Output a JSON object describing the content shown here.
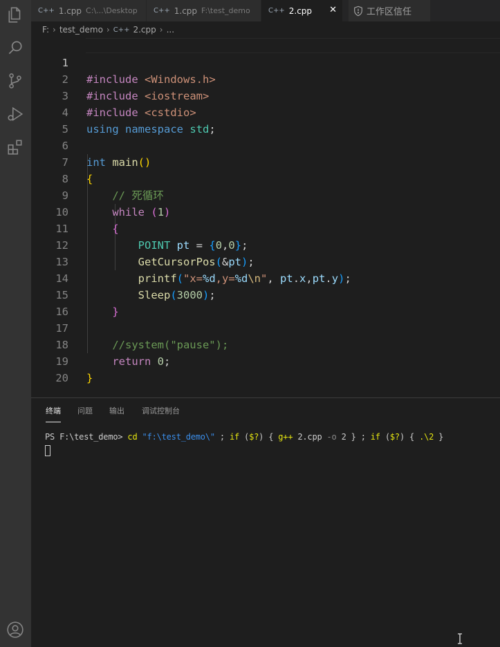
{
  "tabs": [
    {
      "label": "1.cpp",
      "path": "C:\\...\\Desktop",
      "active": false
    },
    {
      "label": "1.cpp",
      "path": "F:\\test_demo",
      "active": false
    },
    {
      "label": "2.cpp",
      "path": "",
      "active": true
    }
  ],
  "tab_icon": "C++",
  "close_glyph": "✕",
  "workspace_trust": "工作区信任",
  "breadcrumb": {
    "drive": "F:",
    "folder": "test_demo",
    "file": "2.cpp",
    "more": "..."
  },
  "editor": {
    "current_line": 1,
    "line_numbers": [
      "1",
      "2",
      "3",
      "4",
      "5",
      "6",
      "7",
      "8",
      "9",
      "10",
      "11",
      "12",
      "13",
      "14",
      "15",
      "16",
      "17",
      "18",
      "19",
      "20"
    ],
    "code": {
      "l1_dir": "#include",
      "l1_hdr": "<Windows.h>",
      "l2_dir": "#include",
      "l2_hdr": "<iostream>",
      "l3_dir": "#include",
      "l3_hdr": "<cstdio>",
      "l4_using": "using",
      "l4_ns": "namespace",
      "l4_std": "std",
      "l4_semi": ";",
      "l6_type": "int",
      "l6_fn": "main",
      "l6_open": "(",
      "l6_close": ")",
      "l7_brace": "{",
      "l8_comment": "// 死循环",
      "l9_kw": "while",
      "l9_open": "(",
      "l9_num": "1",
      "l9_close": ")",
      "l10_brace": "{",
      "l11_type": "POINT",
      "l11_var": "pt",
      "l11_eq": " = ",
      "l11_open": "{",
      "l11_n1": "0",
      "l11_comma": ",",
      "l11_n2": "0",
      "l11_close": "}",
      "l11_semi": ";",
      "l12_fn": "GetCursorPos",
      "l12_open": "(",
      "l12_amp": "&",
      "l12_var": "pt",
      "l12_close": ")",
      "l12_semi": ";",
      "l13_fn": "printf",
      "l13_open": "(",
      "l13_s1": "\"x=",
      "l13_f1": "%d",
      "l13_s2": ",y=",
      "l13_f2": "%d",
      "l13_esc": "\\n",
      "l13_s3": "\"",
      "l13_comma": ", ",
      "l13_a1": "pt",
      "l13_dot1": ".",
      "l13_a2": "x",
      "l13_c2": ",",
      "l13_a3": "pt",
      "l13_dot2": ".",
      "l13_a4": "y",
      "l13_close": ")",
      "l13_semi": ";",
      "l14_fn": "Sleep",
      "l14_open": "(",
      "l14_num": "3000",
      "l14_close": ")",
      "l14_semi": ";",
      "l15_brace": "}",
      "l17_comment": "//system(\"pause\");",
      "l18_kw": "return",
      "l18_num": "0",
      "l18_semi": ";",
      "l19_brace": "}"
    }
  },
  "panel": {
    "tabs": [
      "终端",
      "问题",
      "输出",
      "调试控制台"
    ],
    "terminal": {
      "prompt": "PS F:\\test_demo> ",
      "cd": "cd",
      "cd_arg": "\"f:\\test_demo\\\"",
      "p1": " ; ",
      "if1": "if",
      "p2": " (",
      "q1": "$?",
      "p3": ") { ",
      "gpp": "g++",
      "p4": " 2.cpp ",
      "opt": "-o",
      "p5": " 2 } ; ",
      "if2": "if",
      "p6": " (",
      "q2": "$?",
      "p7": ") { ",
      "run": ".\\2",
      "p8": " }"
    }
  },
  "icons": [
    "explorer-icon",
    "search-icon",
    "source-control-icon",
    "run-debug-icon",
    "extensions-icon",
    "account-icon",
    "shield-icon",
    "text-cursor-icon"
  ],
  "colors": {
    "activity_bar": "#333333",
    "editor_bg": "#1e1e1e",
    "tab_bg": "#2d2d2d",
    "keyword": "#c586c0",
    "type": "#569cd6",
    "string": "#ce9178",
    "function": "#dcdcaa",
    "comment": "#6a9955"
  }
}
